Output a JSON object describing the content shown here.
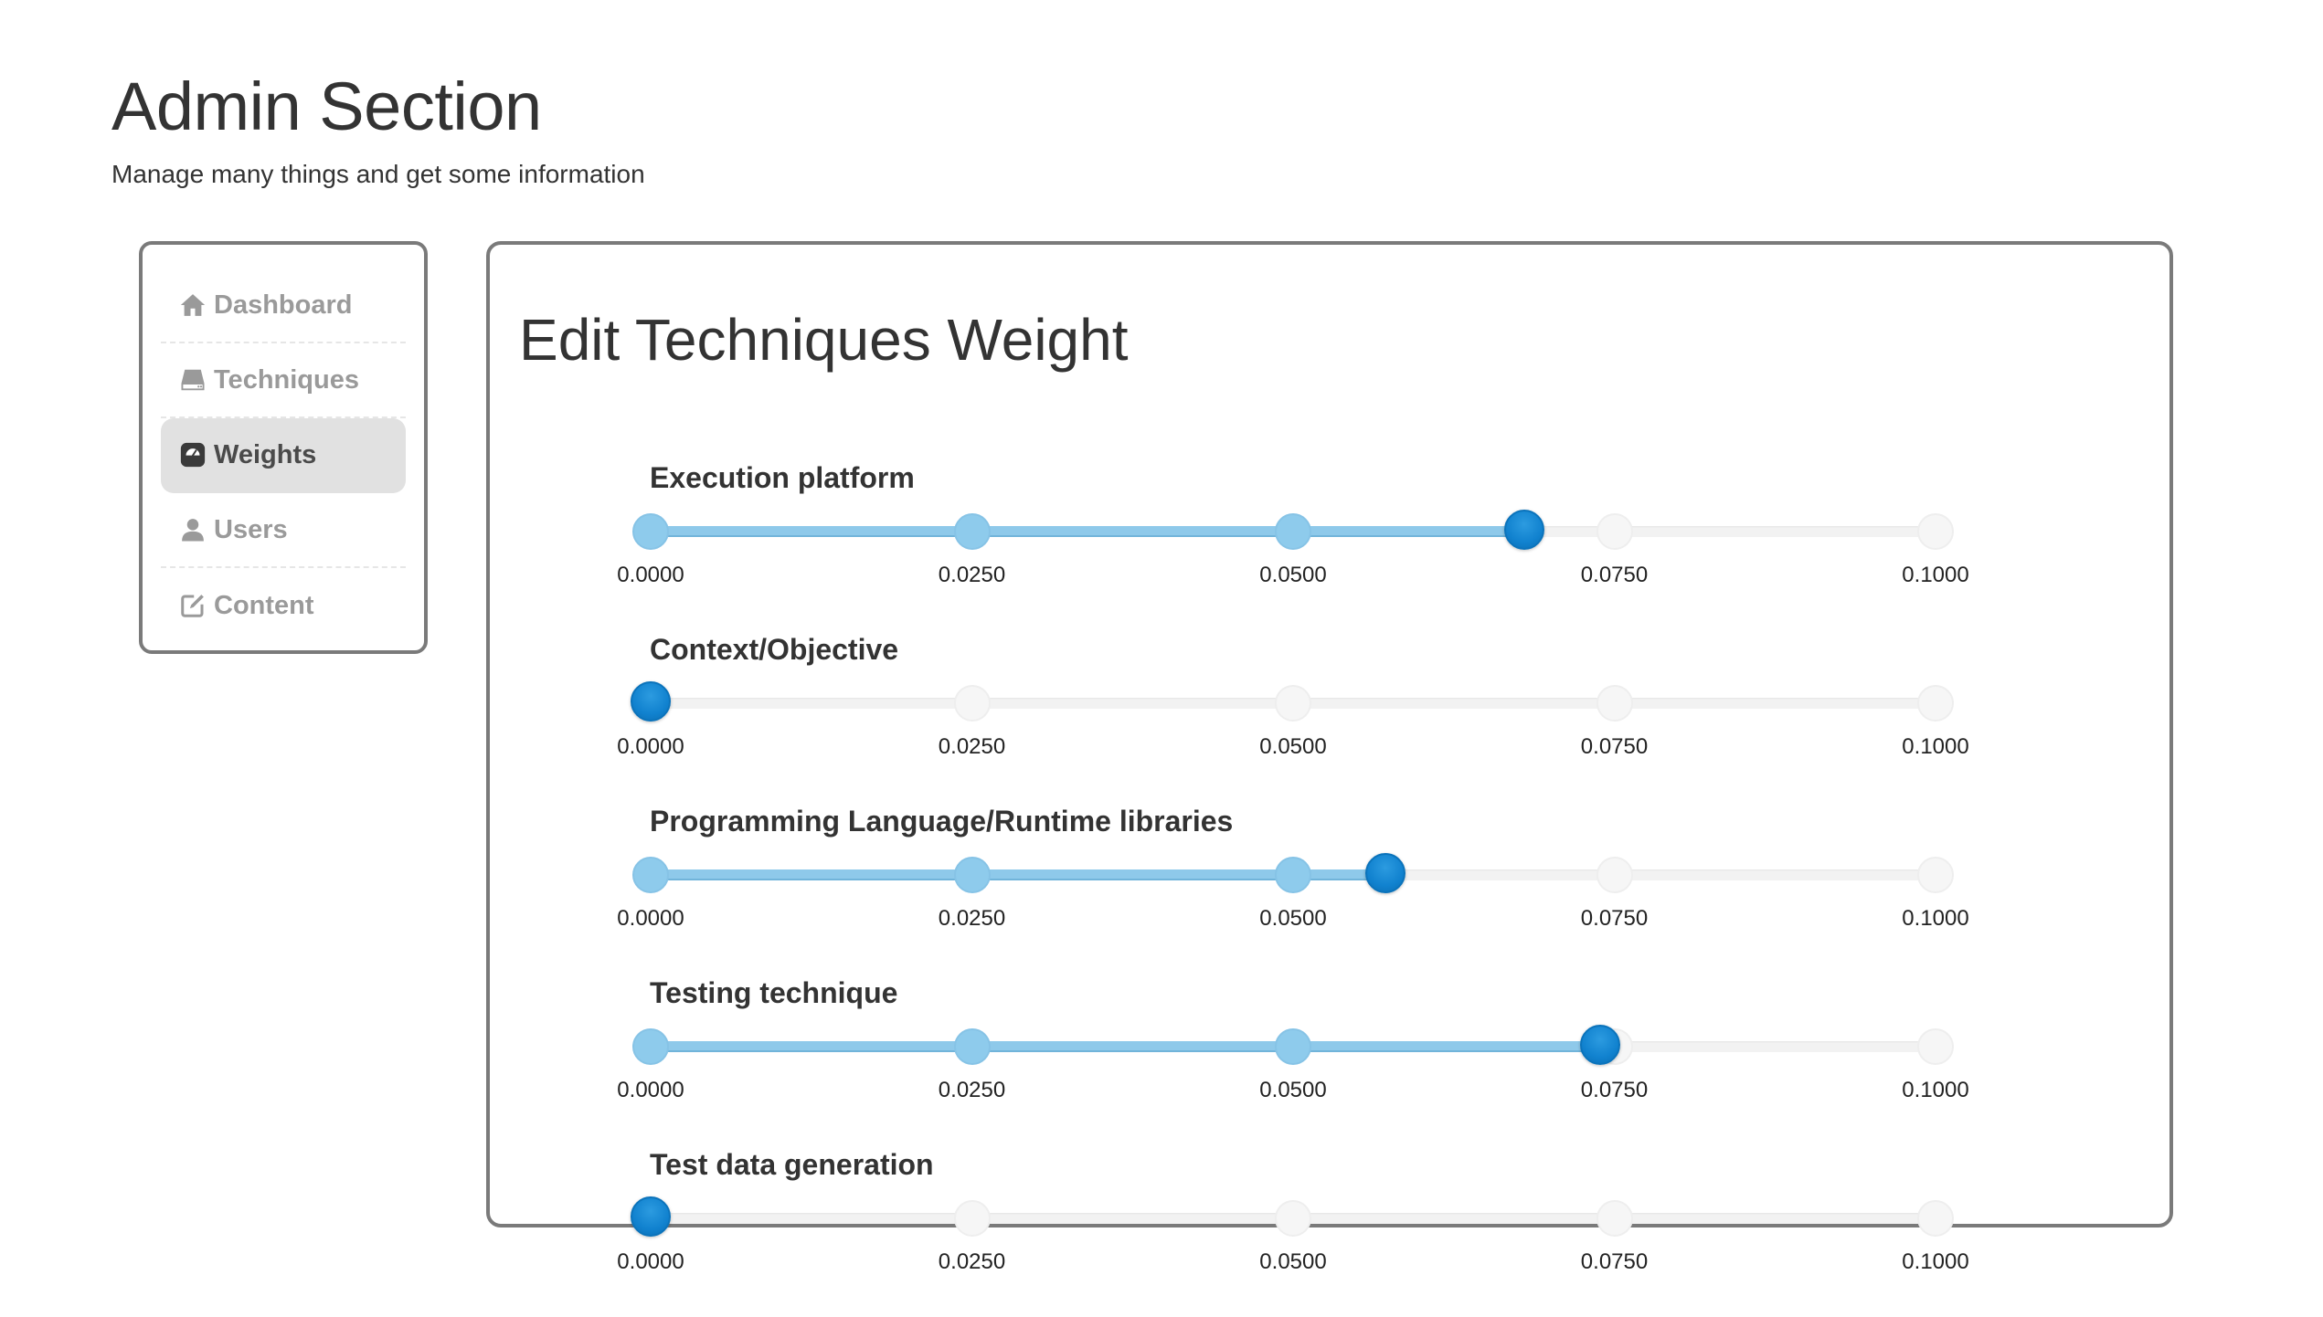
{
  "header": {
    "title": "Admin Section",
    "subtitle": "Manage many things and get some information"
  },
  "sidebar": {
    "items": [
      {
        "label": "Dashboard",
        "icon": "home-icon",
        "active": false
      },
      {
        "label": "Techniques",
        "icon": "drive-icon",
        "active": false
      },
      {
        "label": "Weights",
        "icon": "scale-icon",
        "active": true
      },
      {
        "label": "Users",
        "icon": "user-icon",
        "active": false
      },
      {
        "label": "Content",
        "icon": "edit-icon",
        "active": false
      }
    ]
  },
  "main": {
    "title": "Edit Techniques Weight",
    "scale": {
      "min": 0,
      "max": 0.1,
      "ticks": [
        "0.0000",
        "0.0250",
        "0.0500",
        "0.0750",
        "0.1000"
      ]
    },
    "sliders": [
      {
        "label": "Execution platform",
        "value": 0.068
      },
      {
        "label": "Context/Objective",
        "value": 0.0
      },
      {
        "label": "Programming Language/Runtime libraries",
        "value": 0.0572
      },
      {
        "label": "Testing technique",
        "value": 0.0739
      },
      {
        "label": "Test data generation",
        "value": 0.0
      }
    ]
  },
  "colors": {
    "accent": "#1182cf",
    "fill": "#8ec9ea",
    "border": "#7a7a7a",
    "active_nav_bg": "#e1e1e1"
  }
}
